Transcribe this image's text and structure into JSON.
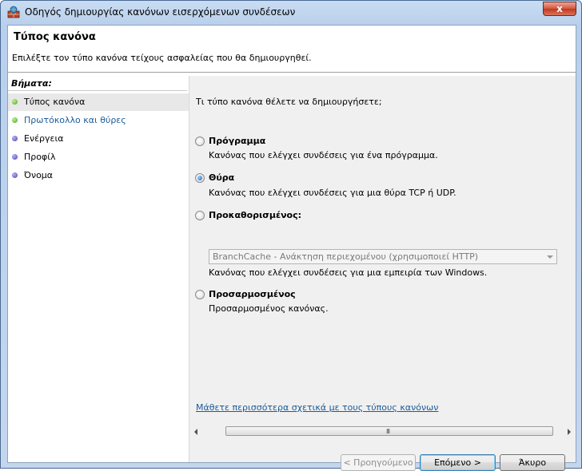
{
  "window": {
    "title": "Οδηγός δημιουργίας κανόνων εισερχόμενων συνδέσεων",
    "close_label": "x"
  },
  "header": {
    "title": "Τύπος κανόνα",
    "description": "Επιλέξτε τον τύπο κανόνα τείχους ασφαλείας που θα δημιουργηθεί."
  },
  "steps": {
    "title": "Βήματα:",
    "items": [
      {
        "label": "Τύπος κανόνα",
        "status": "completed"
      },
      {
        "label": "Πρωτόκολλο και θύρες",
        "status": "completed"
      },
      {
        "label": "Ενέργεια",
        "status": "pending"
      },
      {
        "label": "Προφίλ",
        "status": "pending"
      },
      {
        "label": "Όνομα",
        "status": "pending"
      }
    ]
  },
  "main": {
    "question": "Τι τύπο κανόνα θέλετε να δημιουργήσετε;",
    "selected_option": "port",
    "options": [
      {
        "id": "program",
        "title": "Πρόγραμμα",
        "description": "Κανόνας που ελέγχει συνδέσεις για ένα πρόγραμμα."
      },
      {
        "id": "port",
        "title": "Θύρα",
        "description": "Κανόνας που ελέγχει συνδέσεις για μια θύρα TCP ή UDP."
      },
      {
        "id": "predefined",
        "title": "Προκαθορισμένος:",
        "select_value": "BranchCache - Ανάκτηση περιεχομένου (χρησιμοποιεί HTTP)",
        "description": "Κανόνας που ελέγχει συνδέσεις για μια εμπειρία των Windows."
      },
      {
        "id": "custom",
        "title": "Προσαρμοσμένος",
        "description": "Προσαρμοσμένος κανόνας."
      }
    ],
    "learn_more": "Μάθετε περισσότερα σχετικά με τους τύπους κανόνων",
    "scroll_grip": "III"
  },
  "buttons": {
    "back": "< Προηγούμενο",
    "next": "Επόμενο >",
    "cancel": "Άκυρο"
  },
  "colors": {
    "link": "#1a5a9a",
    "completed_dot": "#3ea52a",
    "pending_dot": "#4440b8"
  }
}
